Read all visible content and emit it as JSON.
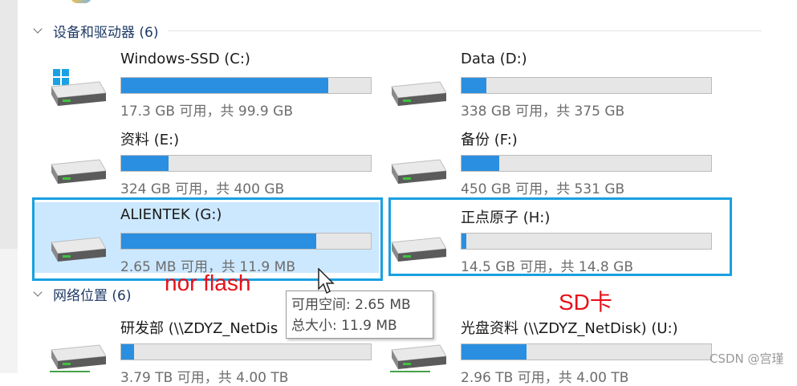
{
  "groups": {
    "devices": {
      "label": "设备和驱动器 (6)"
    },
    "network": {
      "label": "网络位置 (6)"
    }
  },
  "drives": [
    {
      "name": "Windows-SSD (C:)",
      "info": "17.3 GB 可用，共 99.9 GB",
      "used_fraction": 0.83,
      "icon": "windows-drive-icon"
    },
    {
      "name": "Data (D:)",
      "info": "338 GB 可用，共 375 GB",
      "used_fraction": 0.1,
      "icon": "hard-drive-icon"
    },
    {
      "name": "资料 (E:)",
      "info": "324 GB 可用，共 400 GB",
      "used_fraction": 0.19,
      "icon": "hard-drive-icon"
    },
    {
      "name": "备份 (F:)",
      "info": "450 GB 可用，共 531 GB",
      "used_fraction": 0.15,
      "icon": "hard-drive-icon"
    },
    {
      "name": "ALIENTEK (G:)",
      "info": "2.65 MB 可用，共 11.9 MB",
      "used_fraction": 0.78,
      "icon": "hard-drive-icon",
      "selected": true
    },
    {
      "name": "正点原子 (H:)",
      "info": "14.5 GB 可用，共 14.8 GB",
      "used_fraction": 0.02,
      "icon": "hard-drive-icon"
    }
  ],
  "network_drives": [
    {
      "name": "研发部 (\\\\ZDYZ_NetDis",
      "info": "3.79 TB 可用，共 4.00 TB",
      "used_fraction": 0.05,
      "icon": "network-drive-icon"
    },
    {
      "name": "光盘资料 (\\\\ZDYZ_NetDisk) (U:)",
      "info": "2.96 TB 可用，共 4.00 TB",
      "used_fraction": 0.26,
      "icon": "network-drive-icon"
    }
  ],
  "tooltip": {
    "line1": "可用空间: 2.65 MB",
    "line2": "总大小: 11.9 MB"
  },
  "annotations": {
    "nor_flash": "nor flash",
    "sd_card": "SD卡"
  },
  "watermark": "CSDN @宫瑾",
  "colors": {
    "bar_fill": "#2a8fe0",
    "selection": "#cce8ff",
    "highlight_box": "#19a0e0",
    "annotation": "#e8101a"
  }
}
